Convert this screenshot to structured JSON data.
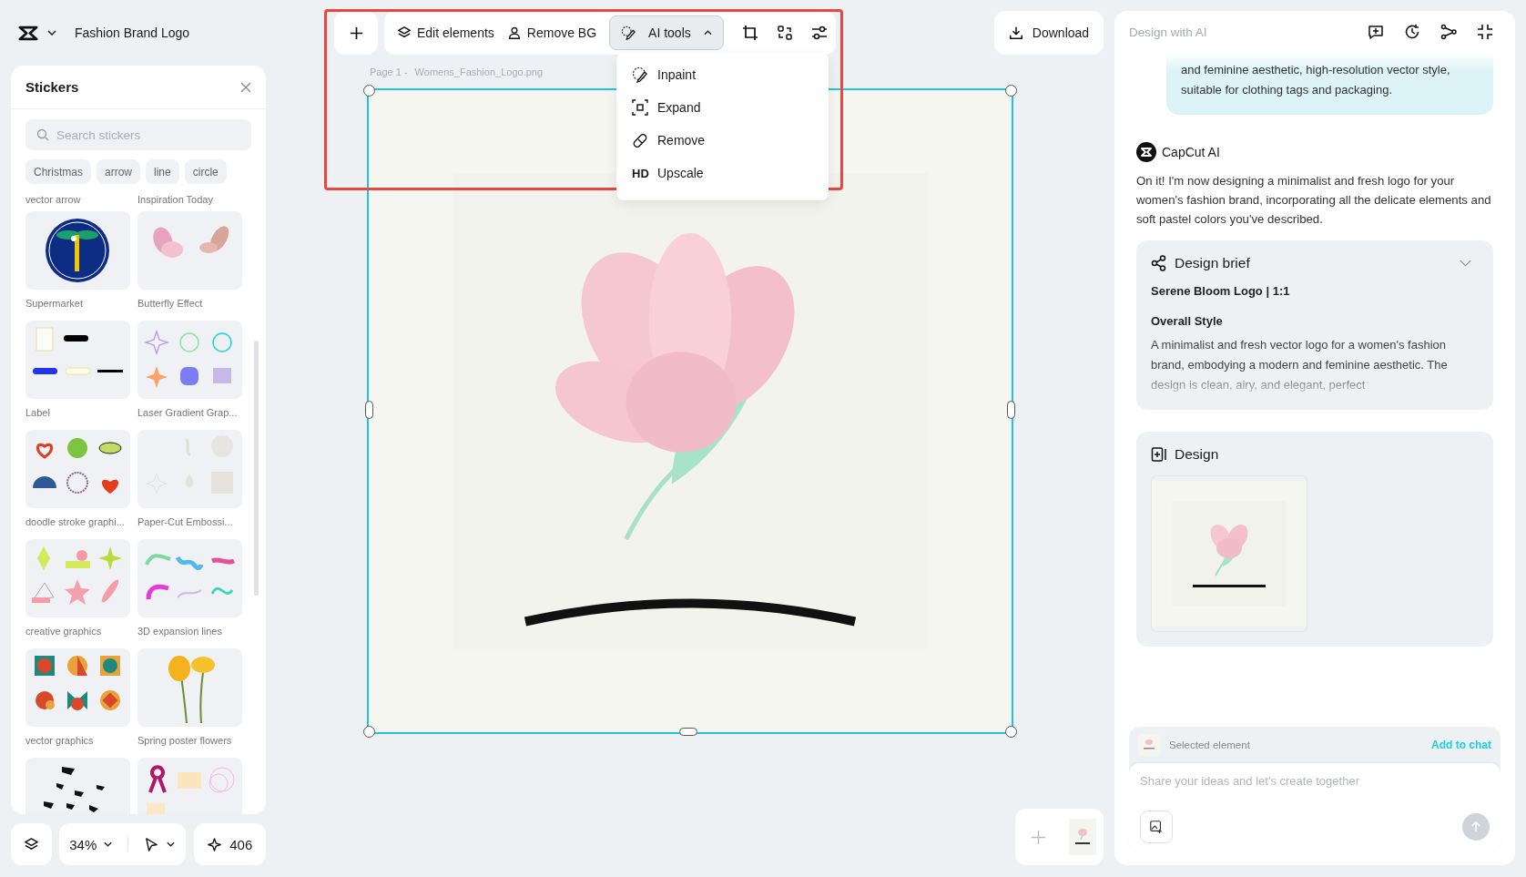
{
  "header": {
    "title": "Fashion Brand Logo"
  },
  "stickers": {
    "title": "Stickers",
    "search": {
      "placeholder": "Search stickers"
    },
    "tags": [
      "Christmas",
      "arrow",
      "line",
      "circle"
    ],
    "cut_labels": [
      "vector arrow",
      "Inspiration Today"
    ],
    "items": [
      {
        "label": "Supermarket",
        "kind": "seal"
      },
      {
        "label": "Butterfly Effect",
        "kind": "butterfly"
      },
      {
        "label": "Label",
        "kind": "label"
      },
      {
        "label": "Laser Gradient Grap...",
        "kind": "gradient"
      },
      {
        "label": "doodle stroke graphi...",
        "kind": "doodle"
      },
      {
        "label": "Paper-Cut Embossi...",
        "kind": "paper"
      },
      {
        "label": "creative graphics",
        "kind": "geometric"
      },
      {
        "label": "3D expansion lines",
        "kind": "squiggle"
      },
      {
        "label": "vector graphics",
        "kind": "mosaic"
      },
      {
        "label": "Spring poster flowers",
        "kind": "flower"
      },
      {
        "kind": "shards"
      },
      {
        "kind": "ribbon"
      }
    ]
  },
  "bottom_bar": {
    "zoom": "34%",
    "credits": "406"
  },
  "toolbar": {
    "items": [
      {
        "label": "Edit elements",
        "kind": "edit"
      },
      {
        "label": "Remove BG",
        "kind": "remove-bg"
      }
    ],
    "ai_tools": {
      "label": "AI tools",
      "expanded": true,
      "menu": [
        {
          "label": "Inpaint",
          "kind": "inpaint"
        },
        {
          "label": "Expand",
          "kind": "expand"
        },
        {
          "label": "Remove",
          "kind": "remove"
        },
        {
          "label": "Upscale",
          "kind": "hd",
          "icon_text": "HD"
        }
      ]
    },
    "tools": [
      {
        "kind": "crop"
      },
      {
        "kind": "swap"
      },
      {
        "kind": "adjust"
      }
    ]
  },
  "download": "Download",
  "page_label": {
    "page": "Page 1 -",
    "file": "Womens_Fashion_Logo.png"
  },
  "chat": {
    "title": "Design with AI",
    "user_message": "and feminine aesthetic, high-resolution vector style, suitable for clothing tags and packaging.",
    "assistant": {
      "name": "CapCut AI",
      "text": "On it! I'm now designing a minimalist and fresh logo for your women's fashion brand, incorporating all the delicate elements and soft pastel colors you've described."
    },
    "brief": {
      "title": "Design brief",
      "subtitle": "Serene Bloom Logo | 1:1",
      "section": "Overall Style",
      "text": "A minimalist and fresh vector logo for a women's fashion brand, embodying a modern and feminine aesthetic. The design is clean, airy, and elegant, perfect"
    },
    "design": {
      "title": "Design"
    },
    "composer": {
      "selected_label": "Selected element",
      "add_label": "Add to chat",
      "placeholder": "Share your ideas and let's create together"
    }
  }
}
